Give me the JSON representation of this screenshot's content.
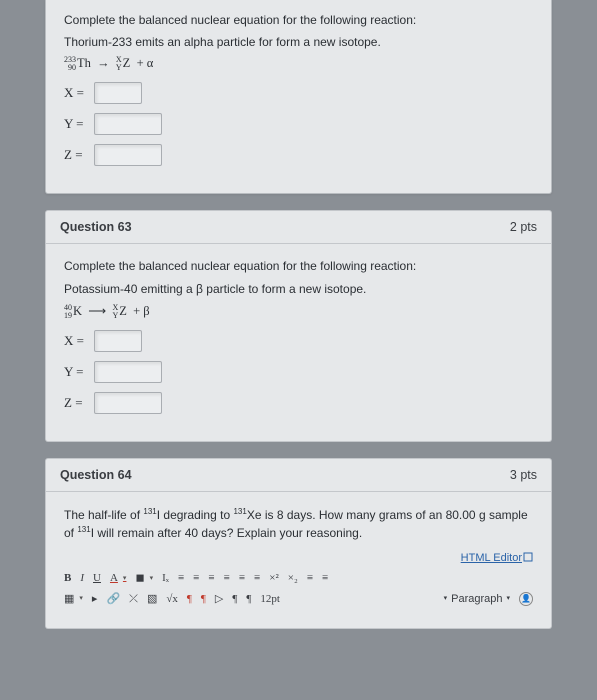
{
  "q62": {
    "prompt1": "Complete the balanced nuclear equation for the following reaction:",
    "prompt2": "Thorium-233 emits an alpha particle for form a new isotope.",
    "iso_top": "233",
    "iso_bot": "90",
    "iso_el": "Th",
    "arrow": "→",
    "prod_x": "X",
    "prod_y": "Y",
    "prod_z": "Z",
    "plus_alpha": "+ α",
    "x_label": "X =",
    "y_label": "Y =",
    "z_label": "Z ="
  },
  "q63": {
    "title": "Question 63",
    "pts": "2 pts",
    "prompt1": "Complete the balanced nuclear equation for the following reaction:",
    "prompt2": "Potassium-40 emitting a β particle to form a new isotope.",
    "iso_top": "40",
    "iso_bot": "19",
    "iso_el": "K",
    "arrow": "⟶",
    "prod_x": "X",
    "prod_y": "Y",
    "prod_z": "Z",
    "plus_beta": "+ β",
    "x_label": "X =",
    "y_label": "Y =",
    "z_label": "Z ="
  },
  "q64": {
    "title": "Question 64",
    "pts": "3 pts",
    "text1a": "The half-life of ",
    "text1b": "I degrading to ",
    "text1c": "Xe is 8 days. How many grams of an 80.00 g sample",
    "sup131a": "131",
    "sup131b": "131",
    "text2a": "of ",
    "sup131c": "131",
    "text2b": "I will remain after 40 days? Explain your reasoning.",
    "editor_link": "HTML Editor",
    "toolbar": {
      "bold": "B",
      "italic": "I",
      "underline": "U",
      "textcolor": "A",
      "bgcolor": "◼",
      "clearfmt": "Iₓ",
      "alignL": "≡",
      "alignC": "≡",
      "alignR": "≡",
      "alignJ": "≡",
      "indent": "≡",
      "outdent": "≡",
      "super": "×²",
      "subsc": "×₂",
      "ul": "≡",
      "ol": "≡",
      "table": "▦",
      "media": "▸",
      "link": "🔗",
      "unlink": "⤫",
      "image": "▧",
      "sqrt": "√x",
      "ltr": "¶",
      "rtl": "¶",
      "play": "▷",
      "pil1": "¶",
      "pil2": "¶",
      "fontsize": "12pt",
      "paragraph": "Paragraph"
    }
  }
}
